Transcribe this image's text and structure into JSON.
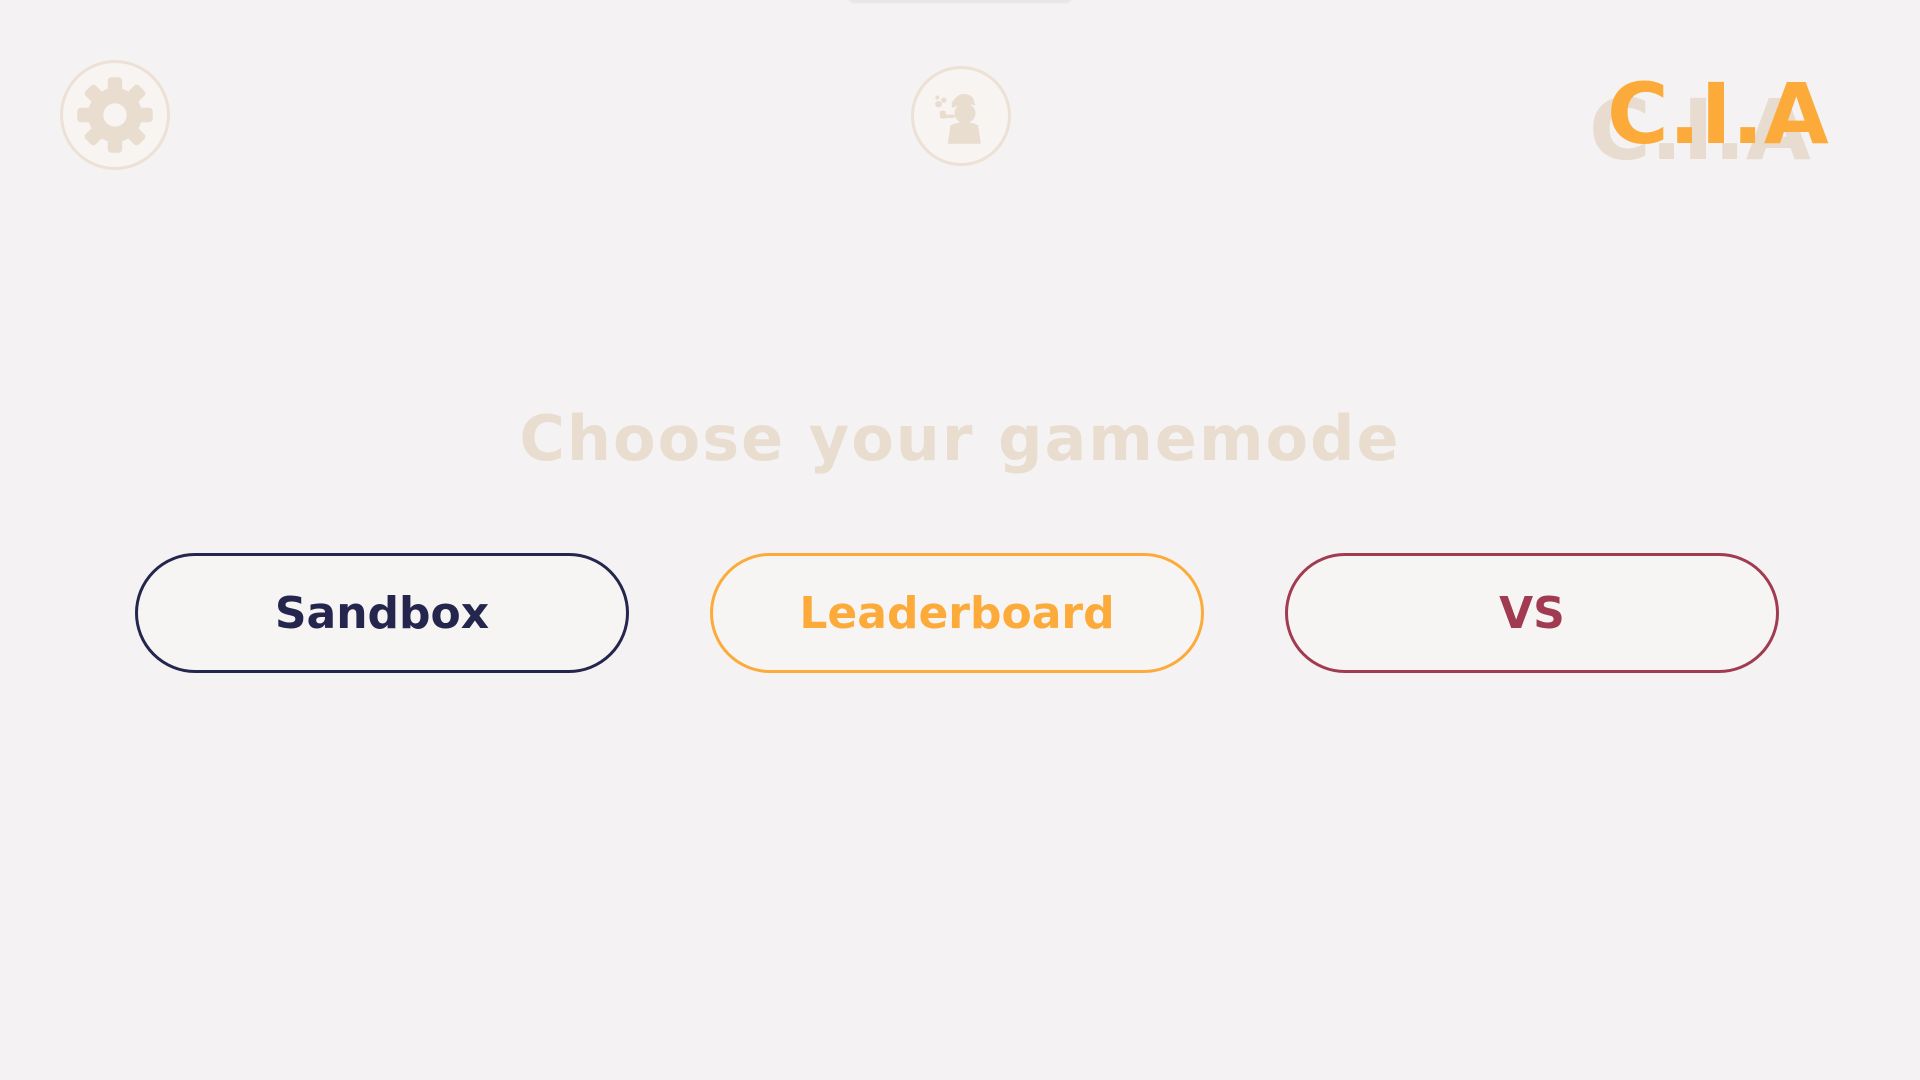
{
  "header": {
    "settings_icon": "gear-icon",
    "profile_icon": "detective-avatar-icon",
    "logo_text": "C.I.A"
  },
  "main": {
    "headline": "Choose your gamemode",
    "modes": [
      {
        "label": "Sandbox",
        "color": "#24264d"
      },
      {
        "label": "Leaderboard",
        "color": "#fcab3b"
      },
      {
        "label": "VS",
        "color": "#a13b52"
      }
    ]
  },
  "colors": {
    "background": "#f4f2f2",
    "muted": "#e9ddd0",
    "accent_orange": "#fcab3b",
    "navy": "#24264d",
    "crimson": "#a13b52"
  }
}
